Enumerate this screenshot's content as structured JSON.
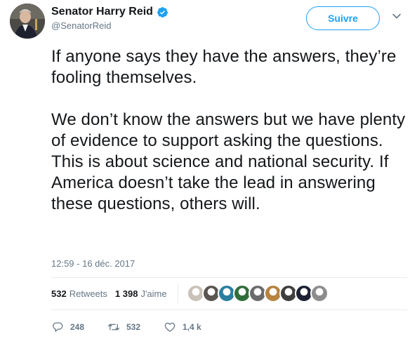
{
  "author": {
    "display_name": "Senator Harry Reid",
    "handle": "@SenatorReid",
    "verified": true,
    "avatar_icon": "avatar-photo"
  },
  "follow_button": {
    "label": "Suivre"
  },
  "caret_icon": "chevron-down-icon",
  "tweet": {
    "paragraphs": [
      "If anyone says they have the answers, they’re fooling themselves.",
      "We don’t know the answers but we have plenty of evidence to support asking the questions. This is about science and national security. If America doesn’t take the lead in answering these questions, others will."
    ],
    "timestamp": "12:59 - 16 déc. 2017"
  },
  "stats": {
    "retweets_count": "532",
    "retweets_label": "Retweets",
    "likes_count": "1 398",
    "likes_label": "J'aime"
  },
  "likers": [
    {
      "name": "liker-avatar-1",
      "color": "#c9c2b8"
    },
    {
      "name": "liker-avatar-2",
      "color": "#5a5550"
    },
    {
      "name": "liker-avatar-3",
      "color": "#2a7fa0"
    },
    {
      "name": "liker-avatar-4",
      "color": "#2f6e3a"
    },
    {
      "name": "liker-avatar-5",
      "color": "#6b6b6b"
    },
    {
      "name": "liker-avatar-6",
      "color": "#b7833f"
    },
    {
      "name": "liker-avatar-7",
      "color": "#3f3f3f"
    },
    {
      "name": "liker-avatar-8",
      "color": "#1c2233"
    },
    {
      "name": "liker-avatar-9",
      "color": "#8d8d8d"
    }
  ],
  "actions": {
    "reply_count": "248",
    "retweet_count": "532",
    "like_count": "1,4 k"
  },
  "colors": {
    "accent": "#1da1f2",
    "text": "#14171a",
    "muted": "#657786",
    "divider": "#e6ecf0"
  }
}
